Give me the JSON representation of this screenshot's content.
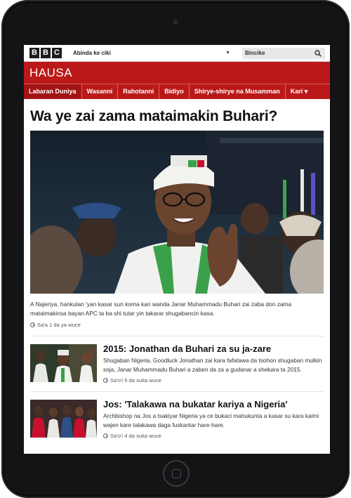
{
  "topbar": {
    "logo_letters": [
      "B",
      "B",
      "C"
    ],
    "language_select": "Abinda ke ciki",
    "search_placeholder": "Bincike"
  },
  "masthead": {
    "brand": "HAUSA",
    "color": "#bb1919"
  },
  "nav": {
    "items": [
      {
        "label": "Labaran Duniya"
      },
      {
        "label": "Wasanni"
      },
      {
        "label": "Rahotanni"
      },
      {
        "label": "Bidiyo"
      },
      {
        "label": "Shirye-shirye na Musamman"
      },
      {
        "label": "Kari ▾"
      }
    ]
  },
  "lead": {
    "headline": "Wa ye zai zama mataimakin Buhari?",
    "summary": "A Najeriya, hankulan 'yan kasar sun koma kan wanda Janar Muhammadu Buhari zai zaba don zama mataimakinsa bayan APC ta ba shi tutar yin takarar shugabancin kasa.",
    "timestamp": "Sa'a 1 da ya wuce"
  },
  "stories": [
    {
      "title": "2015: Jonathan da Buhari za su ja-zare",
      "summary": "Shugaban Nigeria, Goodluck Jonathan zai kara fafatawa da tsohon shugaban mulkin soja, Janar Muhammadu Buhari a zaben da za a gudanar a shekara ta 2015.",
      "timestamp": "Sa'o'i 5 da suka wuce"
    },
    {
      "title": "Jos: 'Talakawa na bukatar kariya a Nigeria'",
      "summary": "Archbishop na Jos a tsakiyar Nigeria ya ce bukaci mahukunta a kasar su kara kaimi wajen kare talakawa daga fuskantar hare-hare.",
      "timestamp": "Sa'o'i 4 da suka wuce"
    }
  ]
}
